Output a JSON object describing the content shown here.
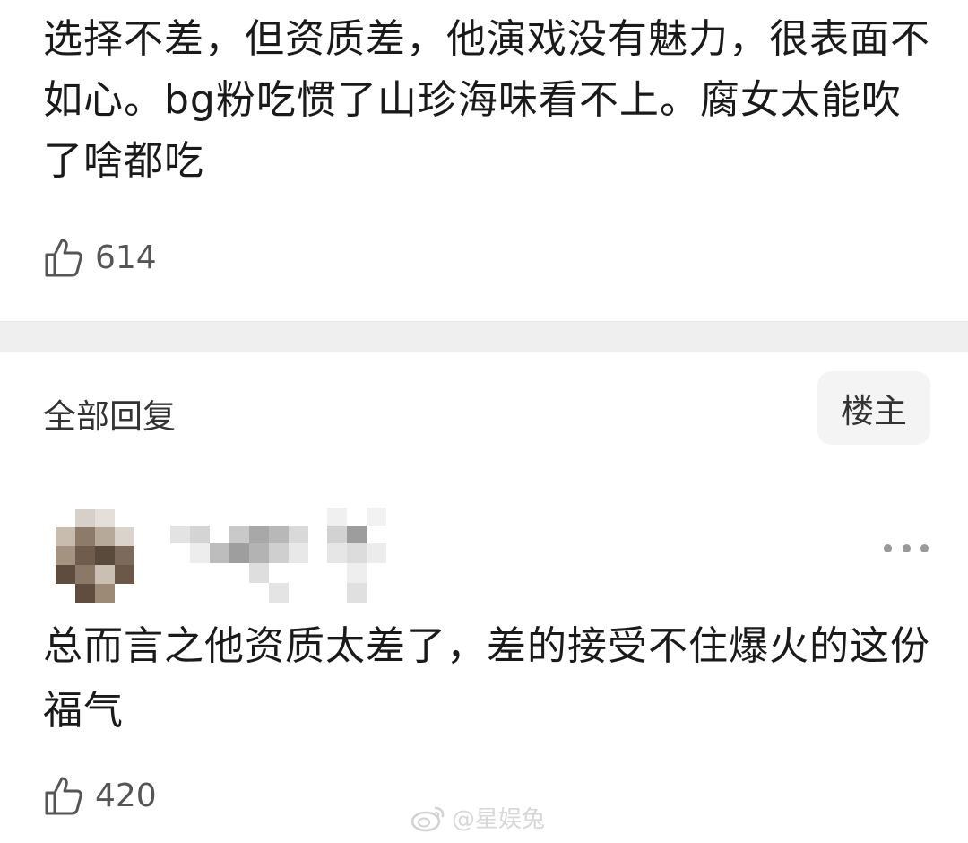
{
  "post": {
    "text": "选择不差，但资质差，他演戏没有魅力，很表面不如心。bg粉吃惯了山珍海味看不上。腐女太能吹了啥都吃",
    "likes": "614"
  },
  "replies": {
    "title": "全部回复",
    "filter_button": "楼主"
  },
  "reply": {
    "text": "总而言之他资质太差了，差的接受不住爆火的这份福气",
    "likes": "420"
  },
  "watermark": {
    "text": "@星娱兔"
  },
  "icons": {
    "like": "thumbs-up-icon",
    "more": "more-dots-icon",
    "watermark": "weibo-logo-icon"
  },
  "colors": {
    "text": "#1a1a1a",
    "muted": "#555555",
    "divider": "#efefef",
    "button_bg": "#f4f4f4"
  }
}
